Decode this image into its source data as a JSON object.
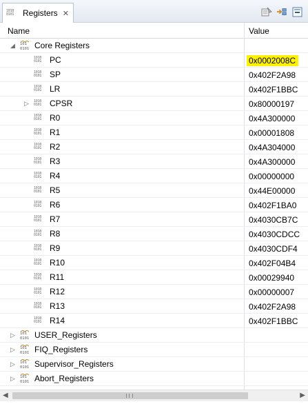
{
  "tab": {
    "title": "Registers",
    "close_glyph": "✕"
  },
  "toolbar": {
    "icons": [
      "clear-icon",
      "add-register-group-icon",
      "collapse-all-icon"
    ]
  },
  "columns": {
    "name": "Name",
    "value": "Value"
  },
  "core": {
    "label": "Core Registers",
    "registers": [
      {
        "name": "PC",
        "value": "0x0002008C",
        "highlighted": true
      },
      {
        "name": "SP",
        "value": "0x402F2A98"
      },
      {
        "name": "LR",
        "value": "0x402F1BBC"
      },
      {
        "name": "CPSR",
        "value": "0x80000197",
        "expandable": true
      },
      {
        "name": "R0",
        "value": "0x4A300000"
      },
      {
        "name": "R1",
        "value": "0x00001808"
      },
      {
        "name": "R2",
        "value": "0x4A304000"
      },
      {
        "name": "R3",
        "value": "0x4A300000"
      },
      {
        "name": "R4",
        "value": "0x00000000"
      },
      {
        "name": "R5",
        "value": "0x44E00000"
      },
      {
        "name": "R6",
        "value": "0x402F1BA0"
      },
      {
        "name": "R7",
        "value": "0x4030CB7C"
      },
      {
        "name": "R8",
        "value": "0x4030CDCC"
      },
      {
        "name": "R9",
        "value": "0x4030CDF4"
      },
      {
        "name": "R10",
        "value": "0x402F04B4"
      },
      {
        "name": "R11",
        "value": "0x00029940"
      },
      {
        "name": "R12",
        "value": "0x00000007"
      },
      {
        "name": "R13",
        "value": "0x402F2A98"
      },
      {
        "name": "R14",
        "value": "0x402F1BBC"
      }
    ]
  },
  "groups": [
    "USER_Registers",
    "FIQ_Registers",
    "Supervisor_Registers",
    "Abort_Registers"
  ],
  "colors": {
    "highlight": "#fff200"
  }
}
